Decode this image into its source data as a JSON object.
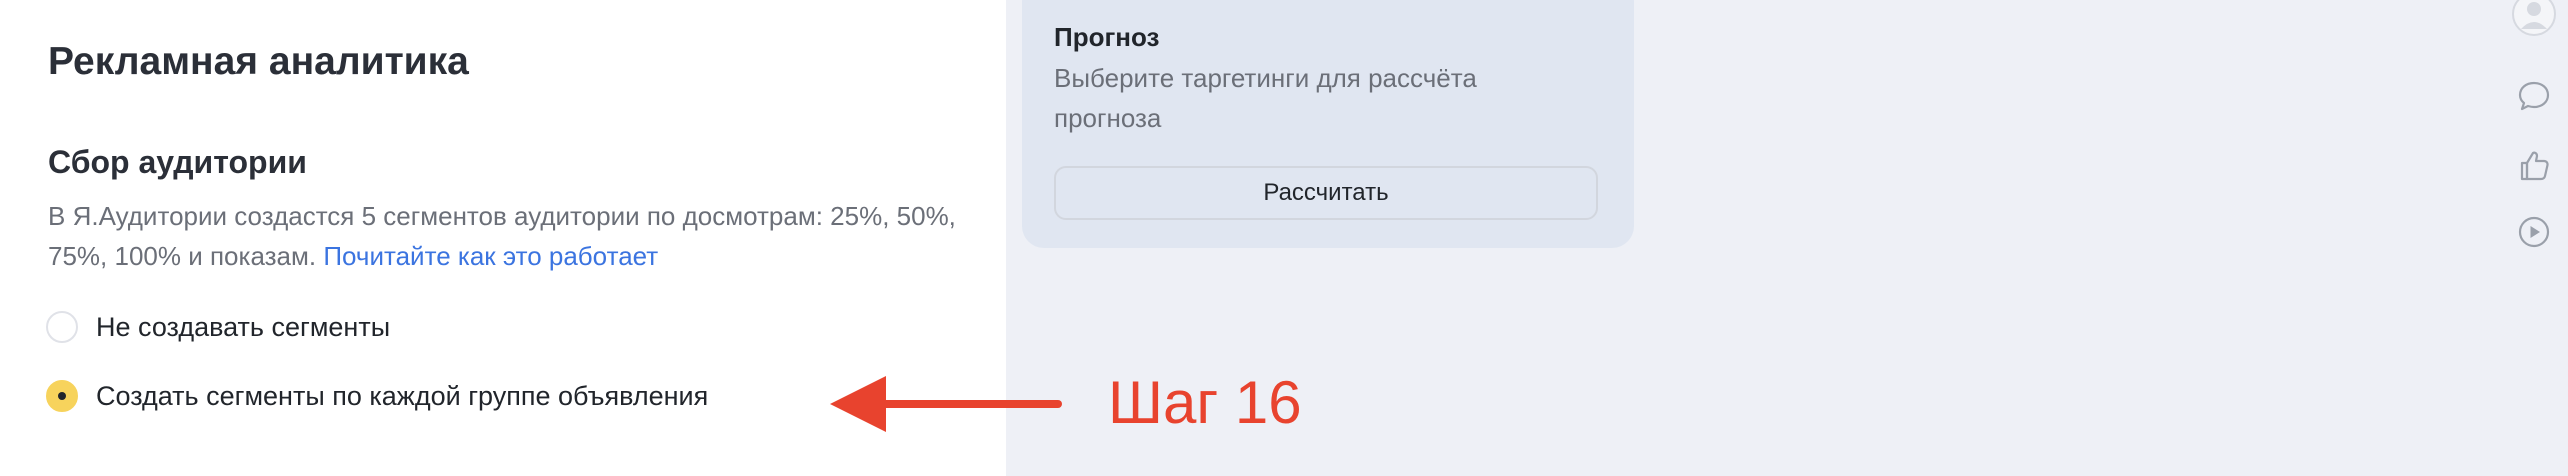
{
  "left": {
    "page_title": "Рекламная аналитика",
    "section_title": "Сбор аудитории",
    "description": "В Я.Аудитории создастся 5 сегментов аудитории по досмотрам: 25%, 50%, 75%, 100% и показам.",
    "link_text": "Почитайте как это работает",
    "options": [
      {
        "label": "Не создавать сегменты",
        "selected": false
      },
      {
        "label": "Создать сегменты по каждой группе объявления",
        "selected": true
      }
    ]
  },
  "forecast": {
    "title": "Прогноз",
    "description": "Выберите таргетинги для рассчёта прогноза",
    "button_label": "Рассчитать"
  },
  "annotation": {
    "label": "Шаг 16",
    "color": "#e8432e"
  },
  "sidebar": {
    "icons": [
      "avatar-icon",
      "comment-icon",
      "like-icon",
      "play-icon"
    ]
  }
}
